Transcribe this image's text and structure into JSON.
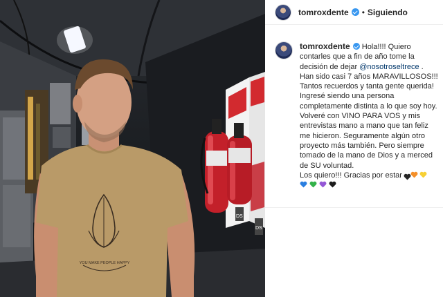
{
  "post": {
    "username": "tomroxdente",
    "verified": true,
    "follow_separator": "•",
    "follow_status": "Siguiendo"
  },
  "caption": {
    "username": "tomroxdente",
    "text_before_mention": " Hola!!!! Quiero contarles que a fin de año tome la decisión de dejar ",
    "mention": "@nosotroseltrece",
    "text_after_mention": " . Han sido casi 7 años MARAVILLOSOS!!! Tantos recuerdos y tanta gente querida! Ingresé siendo una persona completamente distinta a lo que soy hoy. Volveré con VINO PARA VOS y mis entrevistas mano a mano que tan feliz me hicieron. Seguramente algún otro proyecto más también. Pero siempre tomado de la mano de Dios y a merced de SU voluntad.\nLos quiero!!! Gracias por estar",
    "inline_hearts": [
      {
        "icon": "black-heart-icon",
        "color": "#262626",
        "outline": false,
        "small": true
      },
      {
        "icon": "orange-heart-icon",
        "color": "#f4902a"
      },
      {
        "icon": "yellow-heart-icon",
        "color": "#f7d035"
      }
    ],
    "hearts_line": [
      {
        "icon": "blue-heart-icon",
        "color": "#2a7fe0"
      },
      {
        "icon": "green-heart-icon",
        "color": "#33b24a"
      },
      {
        "icon": "purple-heart-icon",
        "color": "#9457d6"
      },
      {
        "icon": "black-heart-icon",
        "color": "#1c1c1c"
      }
    ]
  },
  "photo": {
    "shirt_print_text": "YOU MAKE PEOPLE HAPPY",
    "extinguisher_labels": [
      "DS",
      "DS"
    ]
  },
  "colors": {
    "link": "#00376b",
    "verified": "#3897f0",
    "extinguisher": "#c3202a",
    "shirt": "#b99a68"
  }
}
